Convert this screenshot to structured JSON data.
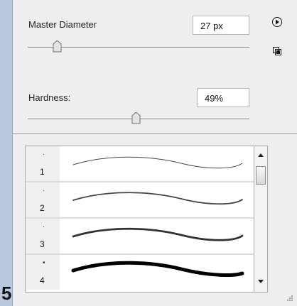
{
  "panel": {
    "master_diameter": {
      "label": "Master Diameter",
      "value": "27 px"
    },
    "hardness": {
      "label": "Hardness:",
      "value": "49%"
    },
    "master_slider_level": 0.1,
    "hardness_slider_level": 0.49
  },
  "brushes": [
    {
      "number": "1",
      "dot": "·"
    },
    {
      "number": "2",
      "dot": "·"
    },
    {
      "number": "3",
      "dot": "·"
    },
    {
      "number": "4",
      "dot": "•"
    }
  ],
  "cutoff_text": "5.",
  "icons": {
    "menu": "play-arrow-icon",
    "new_preset": "new-brush-preset-icon",
    "scroll_up": "scroll-up-arrow-icon",
    "scroll_down": "scroll-down-arrow-icon",
    "resize": "resize-grip-icon"
  }
}
